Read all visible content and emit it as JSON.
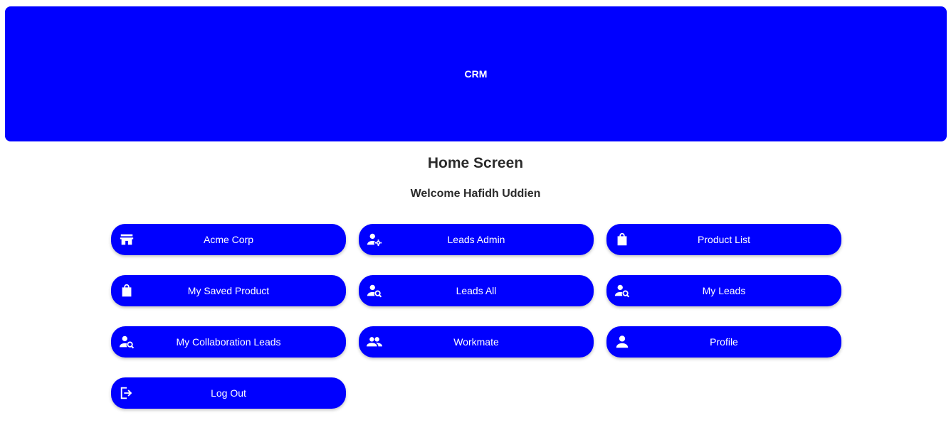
{
  "header": {
    "title": "CRM"
  },
  "page": {
    "title": "Home Screen",
    "welcome": "Welcome Hafidh Uddien"
  },
  "menu": [
    {
      "label": "Acme Corp",
      "icon": "store-icon"
    },
    {
      "label": "Leads Admin",
      "icon": "user-gear-icon"
    },
    {
      "label": "Product List",
      "icon": "shopping-bag-icon"
    },
    {
      "label": "My Saved Product",
      "icon": "shopping-bag-icon"
    },
    {
      "label": "Leads All",
      "icon": "user-search-icon"
    },
    {
      "label": "My Leads",
      "icon": "user-search-icon"
    },
    {
      "label": "My Collaboration Leads",
      "icon": "user-search-icon"
    },
    {
      "label": "Workmate",
      "icon": "people-icon"
    },
    {
      "label": "Profile",
      "icon": "person-icon"
    },
    {
      "label": "Log Out",
      "icon": "logout-icon"
    }
  ],
  "colors": {
    "accent": "#0000ff",
    "text": "#2b2b2b",
    "background": "#ffffff"
  }
}
